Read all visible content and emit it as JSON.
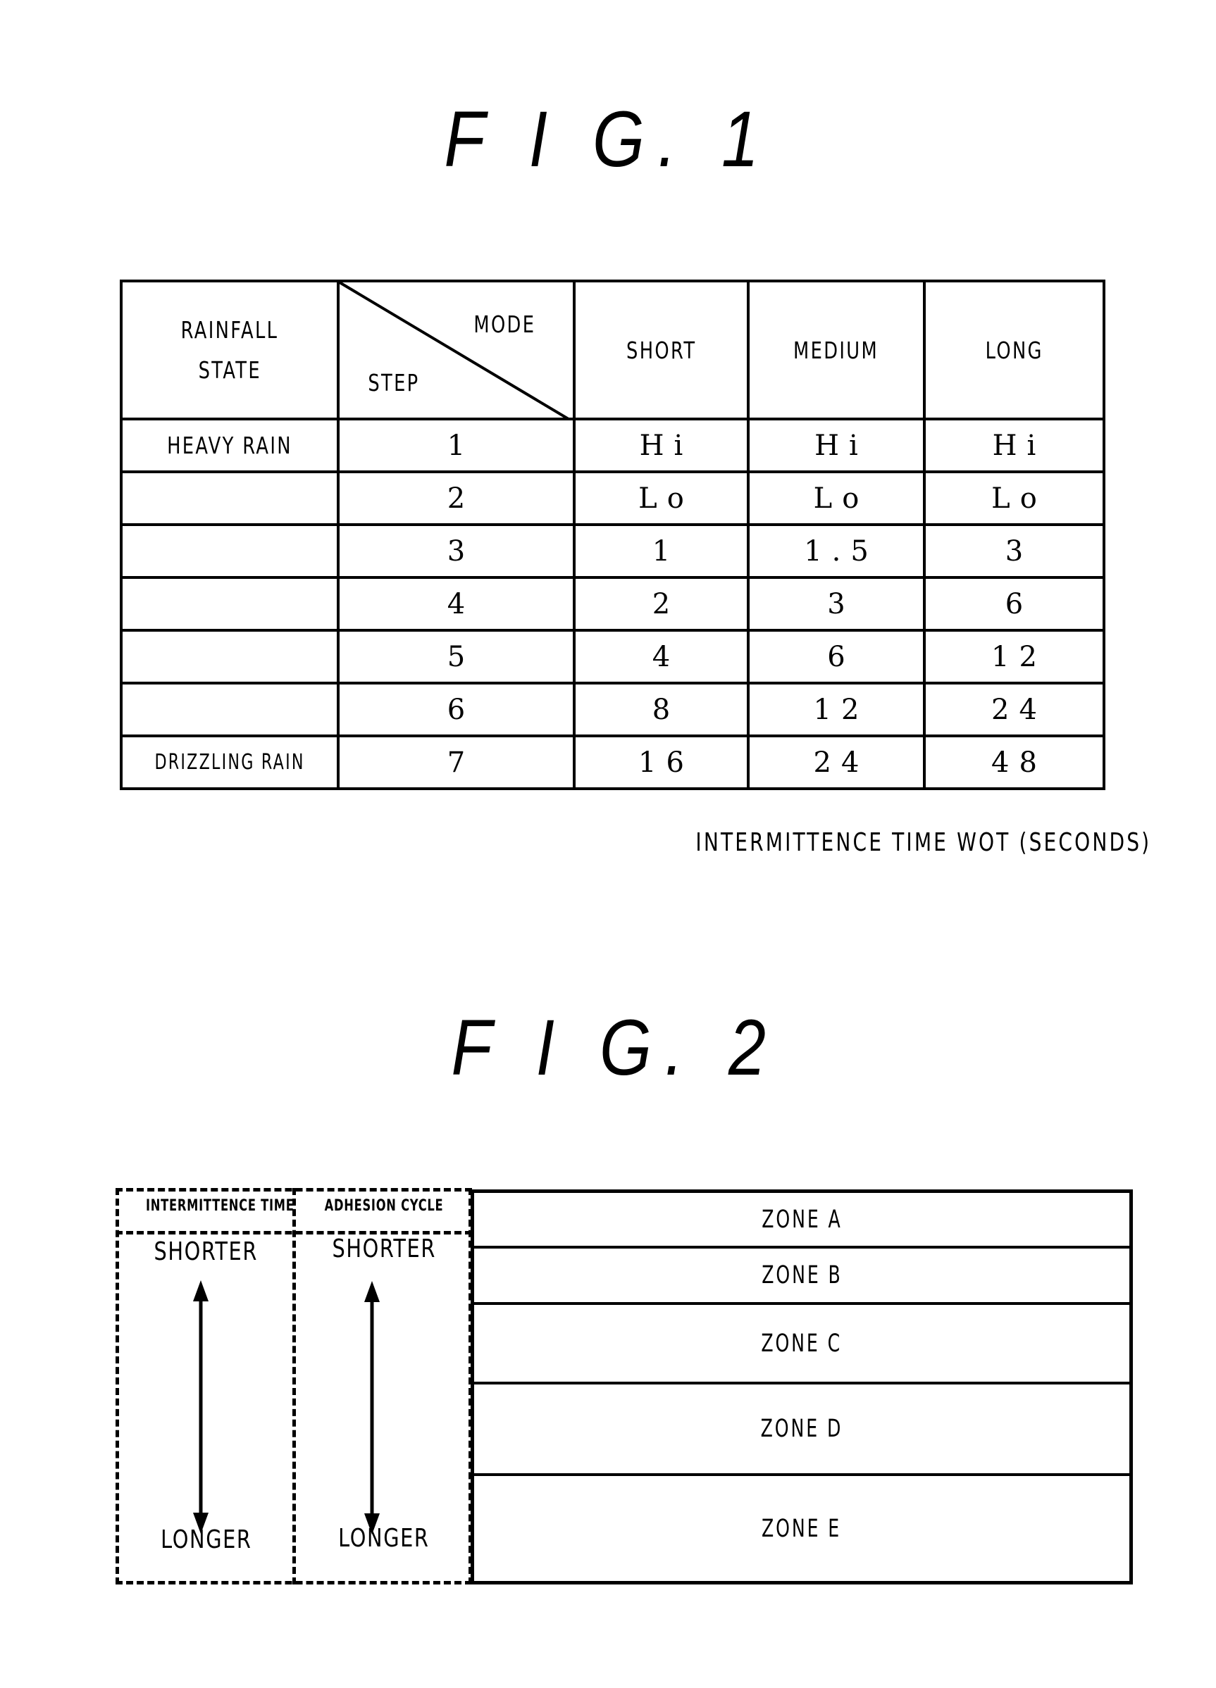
{
  "fig1": {
    "title": "F I G. 1",
    "table": {
      "header": {
        "rainfall_state_line1": "RAINFALL",
        "rainfall_state_line2": "STATE",
        "diag_top": "MODE",
        "diag_bottom": "STEP",
        "modes": [
          "SHORT",
          "MEDIUM",
          "LONG"
        ]
      },
      "rows": [
        {
          "state": "HEAVY RAIN",
          "step": "1",
          "short": "Hi",
          "medium": "Hi",
          "long": "Hi"
        },
        {
          "state": "",
          "step": "2",
          "short": "Lo",
          "medium": "Lo",
          "long": "Lo"
        },
        {
          "state": "",
          "step": "3",
          "short": "1",
          "medium": "1.5",
          "long": "3"
        },
        {
          "state": "",
          "step": "4",
          "short": "2",
          "medium": "3",
          "long": "6"
        },
        {
          "state": "",
          "step": "5",
          "short": "4",
          "medium": "6",
          "long": "12"
        },
        {
          "state": "",
          "step": "6",
          "short": "8",
          "medium": "12",
          "long": "24"
        },
        {
          "state": "DRIZZLING RAIN",
          "step": "7",
          "short": "16",
          "medium": "24",
          "long": "48"
        }
      ]
    },
    "caption": "INTERMITTENCE TIME WOT (SECONDS)"
  },
  "fig2": {
    "title": "F I G. 2",
    "columns": [
      {
        "label": "INTERMITTENCE TIME",
        "top_word": "SHORTER",
        "bottom_word": "LONGER",
        "icon": "double-arrow-vertical-icon"
      },
      {
        "label": "ADHESION CYCLE",
        "top_word": "SHORTER",
        "bottom_word": "LONGER",
        "icon": "double-arrow-vertical-icon"
      }
    ],
    "zones": [
      "ZONE A",
      "ZONE B",
      "ZONE C",
      "ZONE D",
      "ZONE E"
    ]
  }
}
